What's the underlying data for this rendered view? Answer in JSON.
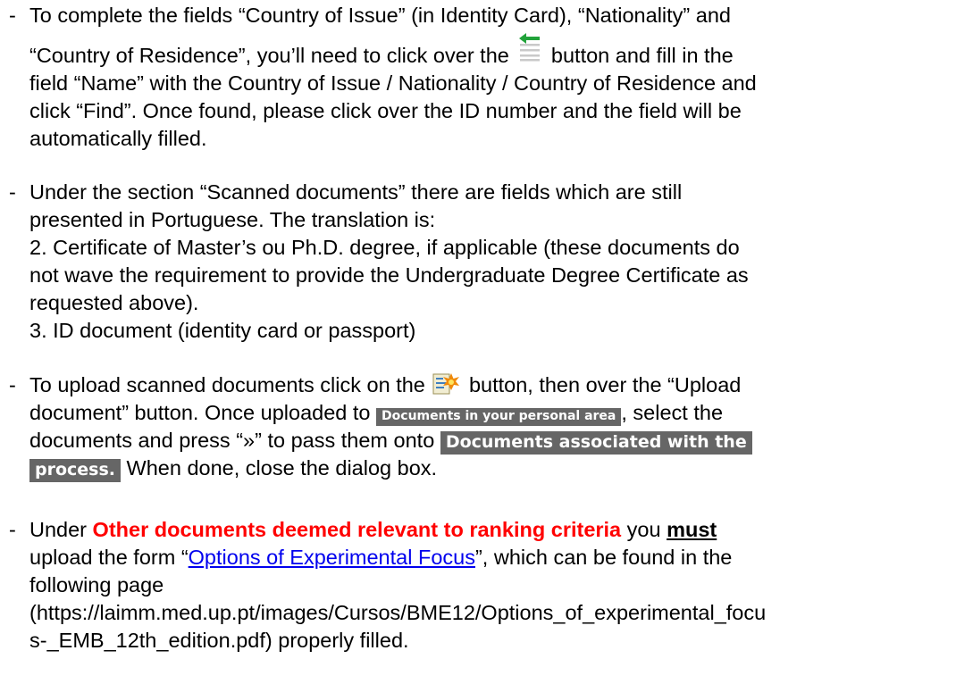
{
  "colors": {
    "text": "#000000",
    "red": "#ff0000",
    "link": "#0000ee",
    "tag_bg": "#666666",
    "icon_green": "#22a33a"
  },
  "bullet": "-",
  "b1": {
    "l1": "To complete the fields “Country of Issue” (in Identity Card), “Nationality” and",
    "l2a": "“Country of Residence”, you’ll need to click over the",
    "l2b": "button and fill in the",
    "l3": "field “Name” with the Country of Issue / Nationality / Country of Residence and",
    "l4": "click “Find”. Once found, please click over the ID number and the field will be",
    "l5": "automatically filled.",
    "icon": "list-arrow-icon"
  },
  "b2": {
    "l1": "Under the section “Scanned documents” there are fields which are still",
    "l2": "presented in Portuguese. The translation is:",
    "l3": "2. Certificate of Master’s ou Ph.D. degree, if applicable (these documents do",
    "l4": "not wave the requirement to provide the Undergraduate Degree Certificate as",
    "l5": "requested above).",
    "l6": "3. ID document (identity card or passport)"
  },
  "b3": {
    "l1a": "To upload scanned documents click on the",
    "l1b": "button, then over the “Upload",
    "l2a": "document” button. Once uploaded to",
    "tag1": "Documents in your personal area",
    "l2b": ", select the",
    "l3a": "documents and press “»” to pass them onto",
    "tag2a": "Documents associated with the",
    "tag2b": "process.",
    "l4b": "When done, close the dialog box.",
    "icon": "upload-document-icon"
  },
  "b4": {
    "l1a": "Under",
    "l1red": "Other documents deemed relevant to ranking criteria",
    "l1b": "you",
    "l1must": "must",
    "l2a": "upload the form “",
    "link": "Options of Experimental Focus",
    "l2b": "”, which can be found in the",
    "l3": "following page",
    "l4": "(https://laimm.med.up.pt/images/Cursos/BME12/Options_of_experimental_focu",
    "l5": "s-_EMB_12th_edition.pdf) properly filled."
  }
}
